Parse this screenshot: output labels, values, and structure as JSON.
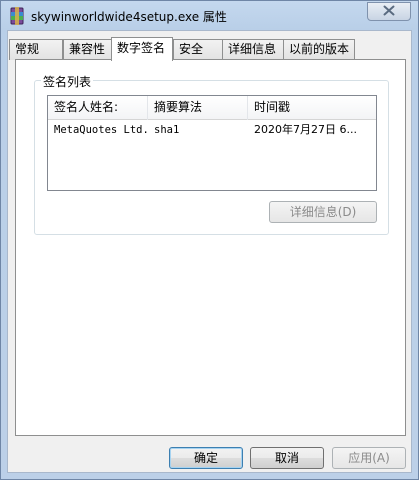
{
  "window": {
    "title": "skywinworldwide4setup.exe 属性",
    "app_icon": "winrar-package-icon",
    "close_icon": "close-icon"
  },
  "tabs": [
    {
      "label": "常规",
      "active": false
    },
    {
      "label": "兼容性",
      "active": false
    },
    {
      "label": "数字签名",
      "active": true
    },
    {
      "label": "安全",
      "active": false
    },
    {
      "label": "详细信息",
      "active": false
    },
    {
      "label": "以前的版本",
      "active": false
    }
  ],
  "signature_list": {
    "legend": "签名列表",
    "columns": [
      "签名人姓名:",
      "摘要算法",
      "时间戳"
    ],
    "rows": [
      {
        "name": "MetaQuotes Ltd.",
        "digest": "sha1",
        "timestamp": "2020年7月27日 6..."
      }
    ],
    "details_button": "详细信息(D)"
  },
  "buttons": {
    "ok": "确定",
    "cancel": "取消",
    "apply": "应用(A)"
  },
  "colors": {
    "titlebar": "#c4d8ee",
    "panel_bg": "#ffffff",
    "disabled_text": "#8b8b8b",
    "default_button_border": "#3c7fb1"
  }
}
